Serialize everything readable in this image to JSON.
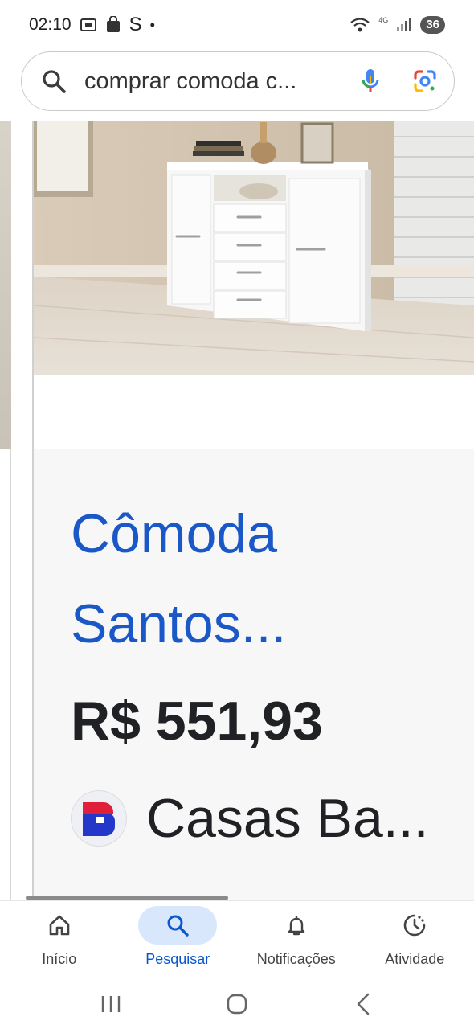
{
  "status_bar": {
    "time": "02:10",
    "carrier_letter": "S",
    "dot": "•",
    "network_type": "4G",
    "battery": "36"
  },
  "search": {
    "query": "comprar comoda c..."
  },
  "product": {
    "title": "Cômoda Santos...",
    "price": "R$ 551,93",
    "store": "Casas Ba..."
  },
  "bottom_nav": {
    "items": [
      {
        "label": "Início"
      },
      {
        "label": "Pesquisar"
      },
      {
        "label": "Notificações"
      },
      {
        "label": "Atividade"
      }
    ],
    "active_index": 1
  },
  "colors": {
    "link_blue": "#1a57c7",
    "active_nav_bg": "#d9e7fd",
    "active_nav_text": "#0b57d0",
    "store_logo_red": "#e0203a",
    "store_logo_blue": "#2338c9"
  }
}
